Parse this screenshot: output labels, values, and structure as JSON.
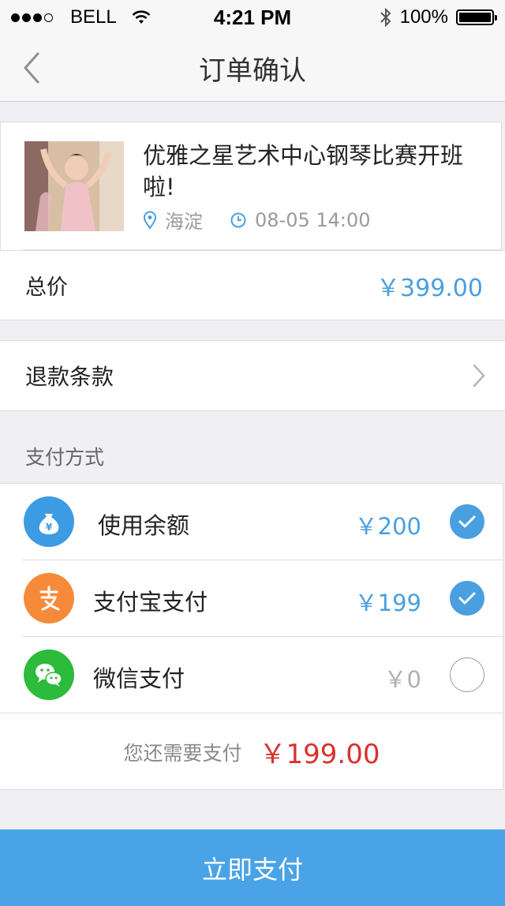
{
  "status_bar": {
    "carrier": "BELL",
    "time": "4:21 PM",
    "battery": "100%"
  },
  "nav": {
    "title": "订单确认"
  },
  "event": {
    "title": "优雅之星艺术中心钢琴比赛开班啦!",
    "location": "海淀",
    "datetime": "08-05 14:00"
  },
  "total": {
    "label": "总价",
    "price": "￥399.00"
  },
  "refund": {
    "label": "退款条款"
  },
  "payment": {
    "section_label": "支付方式",
    "methods": [
      {
        "name": "使用余额",
        "amount": "￥200",
        "selected": true,
        "color": "#3d9be3",
        "icon": "money-bag-icon"
      },
      {
        "name": "支付宝支付",
        "amount": "￥199",
        "selected": true,
        "color": "#f58b3a",
        "icon": "alipay-icon"
      },
      {
        "name": "微信支付",
        "amount": "￥0",
        "selected": false,
        "color": "#2dbb3b",
        "icon": "wechat-icon"
      }
    ],
    "remaining_label": "您还需要支付",
    "remaining_amount": "￥199.00"
  },
  "pay_button": {
    "label": "立即支付"
  },
  "colors": {
    "accent": "#4aa3e6",
    "price_blue": "#4a9fe0",
    "due_red": "#d8312d"
  }
}
